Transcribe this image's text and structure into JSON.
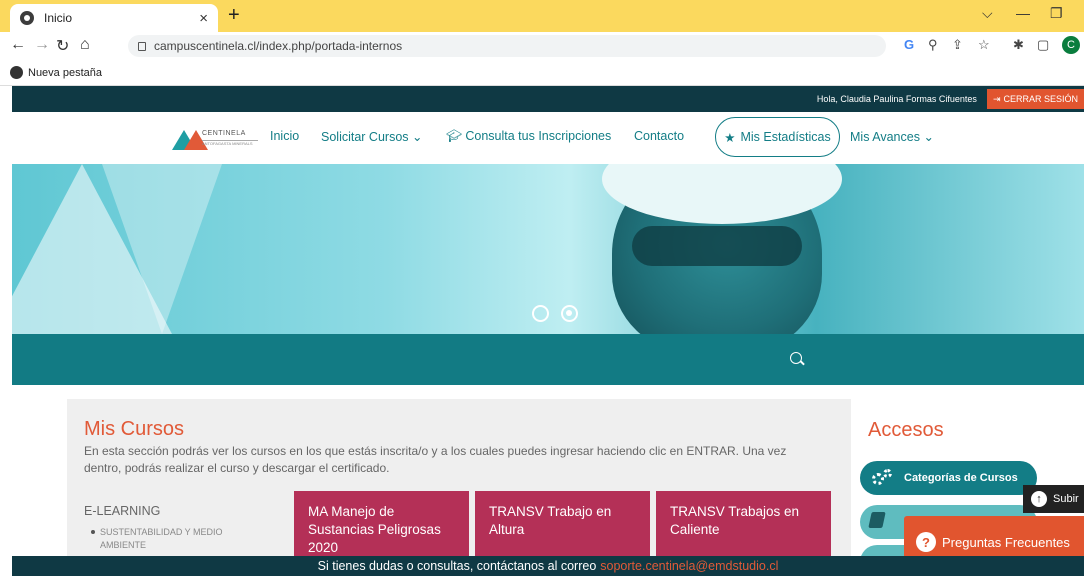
{
  "browser": {
    "tab_title": "Inicio",
    "new_tab_symbol": "+",
    "close_symbol": "×",
    "url": "campuscentinela.cl/index.php/portada-internos",
    "bookmark": "Nueva pestaña",
    "profile_initial": "C",
    "accent": "#fbd95e"
  },
  "topbar": {
    "greeting": "Hola, Claudia Paulina Formas Cifuentes",
    "logout": "CERRAR SESIÓN"
  },
  "nav": {
    "logo_name": "CENTINELA",
    "logo_sub": "ANTOFAGASTA MINERALS",
    "items": [
      "Inicio",
      "Solicitar Cursos",
      "Consulta tus Inscripciones",
      "Contacto",
      "Mis Estadísticas",
      "Mis Avances"
    ]
  },
  "cursos": {
    "title": "Mis Cursos",
    "description": "En esta sección podrás ver los cursos en los que estás inscrita/o y a los cuales puedes ingresar haciendo clic en ENTRAR. Una vez dentro, podrás realizar el curso y descargar el certificado.",
    "category": "E-LEARNING",
    "subcategory": "SUSTENTABILIDAD Y MEDIO AMBIENTE",
    "cards": [
      "MA Manejo de Sustancias Peligrosas 2020",
      "TRANSV Trabajo en Altura",
      "TRANSV Trabajos en Caliente"
    ]
  },
  "accesos": {
    "title": "Accesos",
    "item1": "Categorías de Cursos"
  },
  "floating": {
    "subir": "Subir",
    "faq": "Preguntas Frecuentes"
  },
  "footer": {
    "text": "Si tienes dudas o consultas, contáctanos al correo",
    "email": "soporte.centinela@emdstudio.cl"
  },
  "colors": {
    "teal": "#137d86",
    "dark": "#0f3944",
    "orange": "#e15a38",
    "card": "#b43057"
  }
}
